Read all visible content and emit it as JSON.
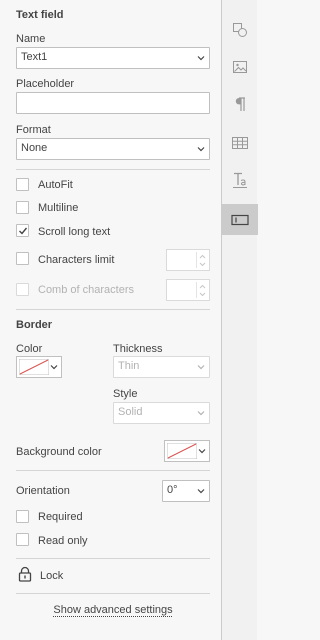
{
  "panel": {
    "title": "Text field",
    "name": {
      "label": "Name",
      "value": "Text1"
    },
    "placeholder": {
      "label": "Placeholder",
      "value": ""
    },
    "format": {
      "label": "Format",
      "value": "None"
    },
    "checkboxes": {
      "autofit": {
        "label": "AutoFit",
        "checked": false
      },
      "multiline": {
        "label": "Multiline",
        "checked": false
      },
      "scroll": {
        "label": "Scroll long text",
        "checked": true
      },
      "limit": {
        "label": "Characters limit",
        "checked": false
      },
      "comb": {
        "label": "Comb of characters",
        "checked": false,
        "disabled": true
      }
    },
    "border": {
      "title": "Border",
      "color_label": "Color",
      "thickness_label": "Thickness",
      "thickness_value": "Thin",
      "style_label": "Style",
      "style_value": "Solid"
    },
    "background_label": "Background color",
    "orientation": {
      "label": "Orientation",
      "value": "0°"
    },
    "required": {
      "label": "Required",
      "checked": false
    },
    "readonly": {
      "label": "Read only",
      "checked": false
    },
    "lock_label": "Lock",
    "advanced_link": "Show advanced settings"
  },
  "rail": {
    "items": [
      "shape-settings-icon",
      "image-settings-icon",
      "paragraph-settings-icon",
      "table-settings-icon",
      "text-art-settings-icon",
      "form-settings-icon"
    ],
    "active": "form-settings-icon"
  },
  "colors": {
    "no_color_line": "#d9534f",
    "active_rail": "#cbcbcb"
  }
}
